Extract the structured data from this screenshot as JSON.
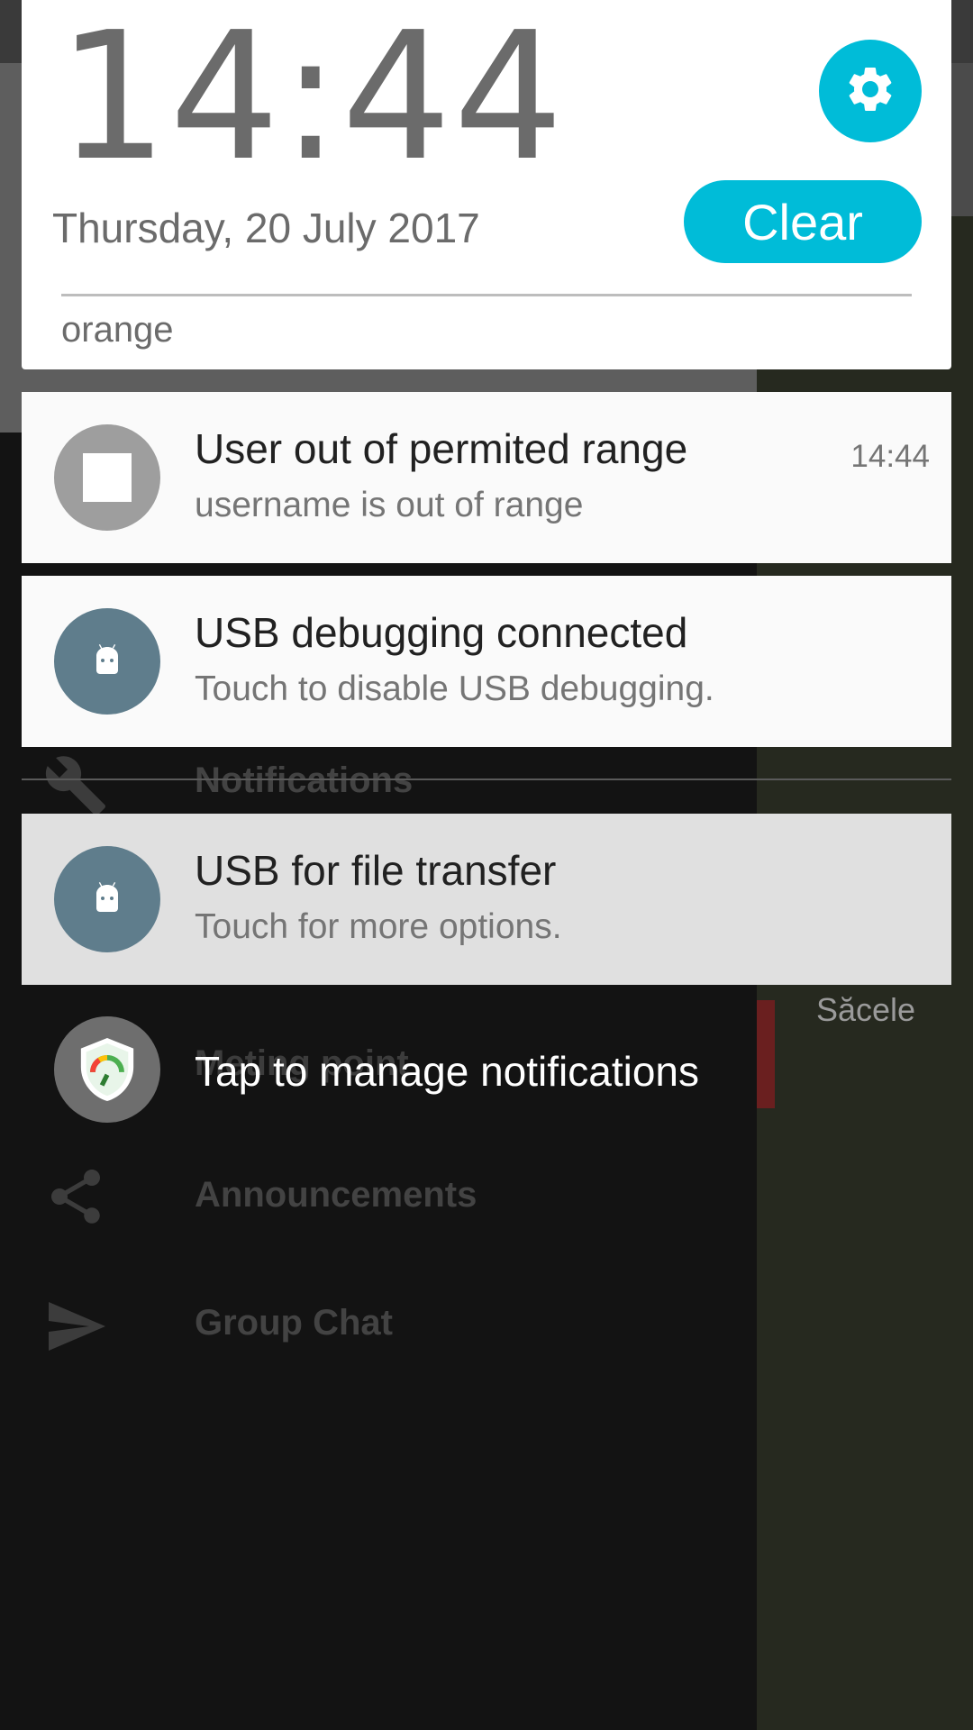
{
  "header": {
    "time": "14:44",
    "date": "Thursday, 20 July 2017",
    "clear_label": "Clear",
    "carrier": "orange",
    "settings_icon": "gear-icon",
    "accent_color": "#00bcd8"
  },
  "notifications": [
    {
      "title": "User out of permited range",
      "text": "username is out of range",
      "time": "14:44",
      "icon": "stop-square-icon",
      "icon_color": "#9e9e9e"
    },
    {
      "title": "USB debugging connected",
      "text": "Touch to disable USB debugging.",
      "icon": "android-icon",
      "icon_color": "#5f7d8c"
    },
    {
      "title": "USB for file transfer",
      "text": "Touch for more options.",
      "icon": "android-icon",
      "icon_color": "#5f7d8c"
    }
  ],
  "manage": {
    "label": "Tap to manage notifications",
    "icon": "shield-gauge-icon"
  },
  "background_app": {
    "drawer_items": [
      {
        "label": "Notifications",
        "icon": "wrench-icon"
      },
      {
        "label": "Meting point",
        "icon": "pin-icon"
      },
      {
        "label": "Announcements",
        "icon": "share-icon"
      },
      {
        "label": "Group Chat",
        "icon": "send-icon"
      }
    ],
    "map_label": "Săcele"
  }
}
